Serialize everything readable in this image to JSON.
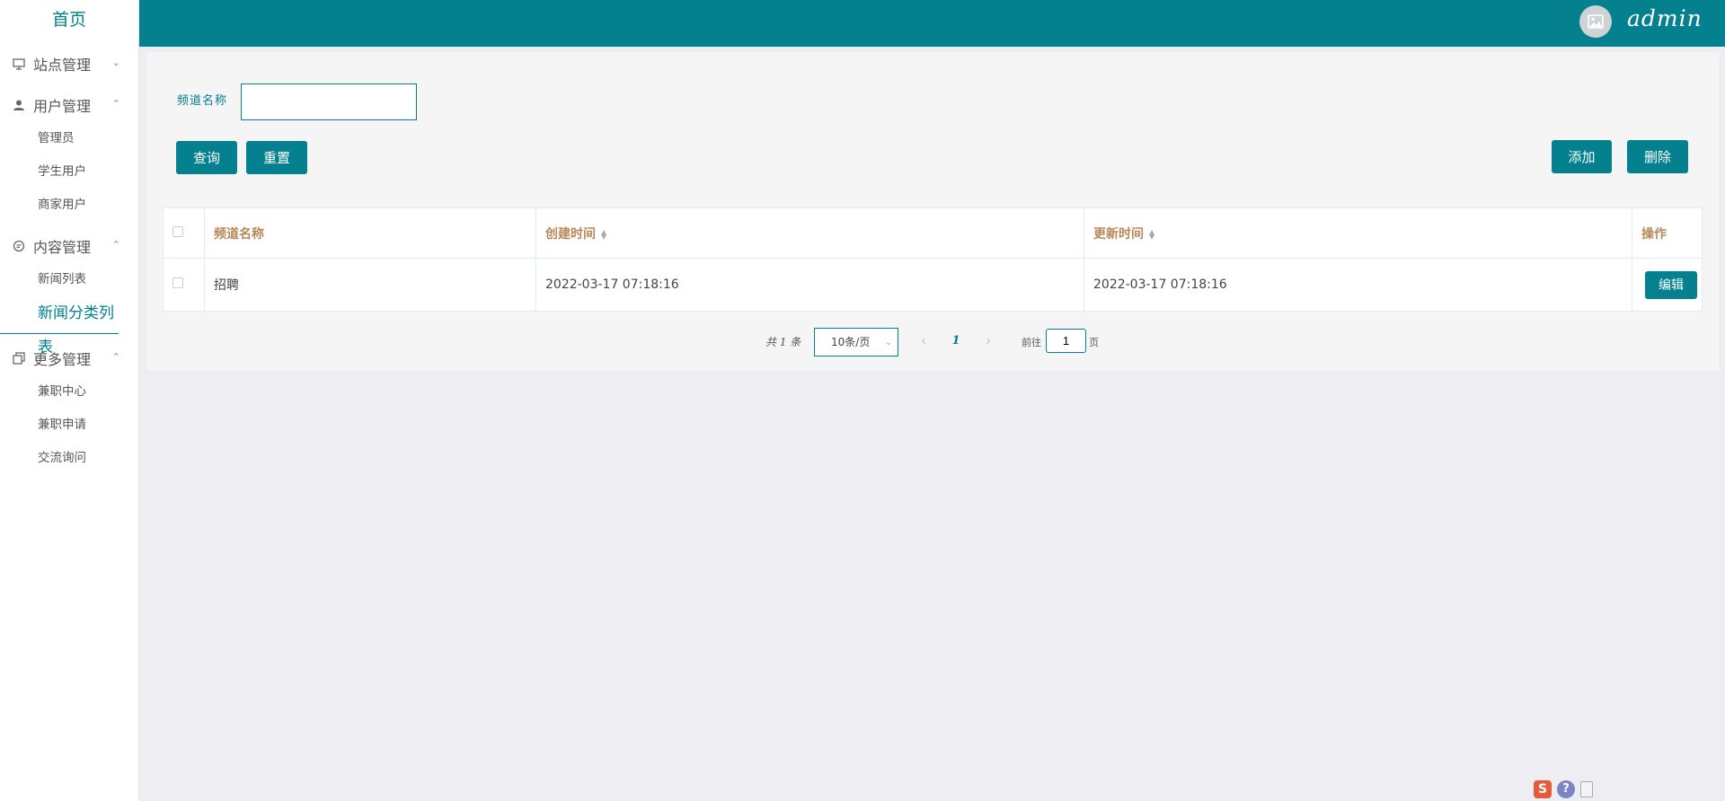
{
  "colors": {
    "primary": "#04808f",
    "header_text": "#b8885a",
    "background": "#eeeef2"
  },
  "sidebar": {
    "home": "首页",
    "groups": [
      {
        "label": "站点管理",
        "icon": "monitor-icon",
        "expanded": false,
        "items": []
      },
      {
        "label": "用户管理",
        "icon": "user-icon",
        "expanded": true,
        "items": [
          "管理员",
          "学生用户",
          "商家用户"
        ]
      },
      {
        "label": "内容管理",
        "icon": "chat-icon",
        "expanded": true,
        "items": [
          "新闻列表",
          "新闻分类列表"
        ],
        "active_item": "新闻分类列表"
      },
      {
        "label": "更多管理",
        "icon": "copy-icon",
        "expanded": true,
        "items": [
          "兼职中心",
          "兼职申请",
          "交流询问"
        ]
      }
    ]
  },
  "header": {
    "username": "admin",
    "avatar_icon": "image-icon"
  },
  "search": {
    "label": "频道名称",
    "value": "",
    "placeholder": ""
  },
  "toolbar": {
    "query": "查询",
    "reset": "重置",
    "add": "添加",
    "delete": "删除"
  },
  "table": {
    "columns": [
      "频道名称",
      "创建时间",
      "更新时间",
      "操作"
    ],
    "rows": [
      {
        "name": "招聘",
        "created": "2022-03-17 07:18:16",
        "updated": "2022-03-17 07:18:16",
        "action": "编辑"
      }
    ]
  },
  "pagination": {
    "total_text": "共 1 条",
    "page_size": "10条/页",
    "current_page": "1",
    "goto_label": "前往",
    "goto_value": "1",
    "page_suffix": "页"
  },
  "tray": {
    "s_label": "S",
    "help_label": "?"
  }
}
